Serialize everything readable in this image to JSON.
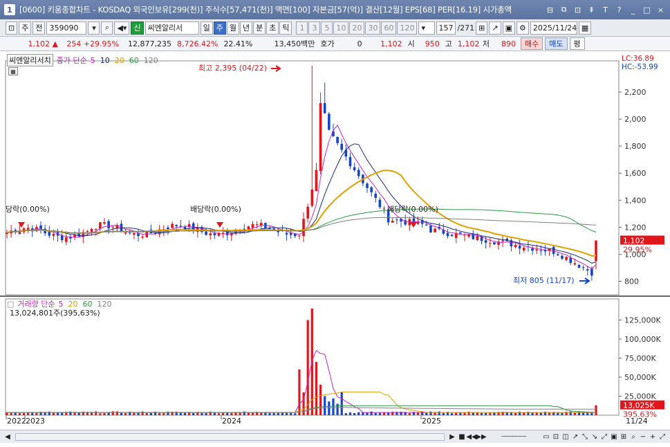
{
  "window": {
    "icon": "1",
    "title": "[0600] 키움종합차트 - KOSDAQ 외국인보유[299(천)] 주식수[57,471(천)] 액면[100] 자본금[57(억)] 결산[12월] EPS[68] PER[16.19] 시가총액",
    "buttons": [
      "⊟",
      "⧉",
      "⊡",
      "⇞",
      "T",
      "?",
      "_",
      "□",
      "×"
    ]
  },
  "toolbar": {
    "period": "주",
    "market": "전",
    "code": "359090",
    "badge": "신",
    "stock_name": "씨엔알리서",
    "periods": [
      {
        "label": "일",
        "active": false
      },
      {
        "label": "주",
        "active": true
      },
      {
        "label": "월",
        "active": false
      },
      {
        "label": "년",
        "active": false
      },
      {
        "label": "분",
        "active": false
      },
      {
        "label": "초",
        "active": false
      },
      {
        "label": "틱",
        "active": false
      }
    ],
    "intervals": [
      "1",
      "3",
      "5",
      "10",
      "20",
      "30",
      "60",
      "120"
    ],
    "count": "157",
    "total": "/271",
    "date": "2025/11/24"
  },
  "quote": {
    "price": "1,102",
    "change": "254",
    "change_pct": "+29.95%",
    "volume": "12,877,235",
    "volume_pct": "8,726.42%",
    "turnover": "22.41%",
    "amount": "13,450백만",
    "hoga_label": "호가",
    "hoga_value": "0",
    "last": "1,102",
    "open_label": "시",
    "open": "950",
    "high_label": "고",
    "high": "1,102",
    "low_label": "저",
    "low": "890",
    "buy": "매수",
    "sell": "매도",
    "eval": "평"
  },
  "price_panel": {
    "name": "씨엔알리서치",
    "legend_title": "종가 단순",
    "ma": [
      {
        "label": "5",
        "color": "#cc22cc"
      },
      {
        "label": "10",
        "color": "#1a2a80"
      },
      {
        "label": "20",
        "color": "#e0a000"
      },
      {
        "label": "60",
        "color": "#2a9a44"
      },
      {
        "label": "120",
        "color": "#808080"
      }
    ],
    "lc": "LC:36.89",
    "hc": "HC:-53.99",
    "high_note": "최고 2,395 (04/22)",
    "low_note": "최저 805 (11/17)",
    "dividends": [
      "당락(0.00%)",
      "배당락(0.00%)",
      "배당락(0.00%)"
    ],
    "yticks": [
      "2,200",
      "2,000",
      "1,800",
      "1,600",
      "1,400",
      "1,200",
      "1,000",
      "800"
    ],
    "current_price": "1,102",
    "current_pct": "29.95%"
  },
  "volume_panel": {
    "legend_title": "거래량 단순",
    "ma": [
      {
        "label": "5",
        "color": "#cc22cc"
      },
      {
        "label": "20",
        "color": "#e0a000"
      },
      {
        "label": "60",
        "color": "#2a9a44"
      },
      {
        "label": "120",
        "color": "#808080"
      }
    ],
    "current_text": "13,024,801주(395,63%)",
    "yticks": [
      "125,000K",
      "100,000K",
      "75,000K",
      "50,000K",
      "25,000K"
    ],
    "current_vol": "13,025K",
    "current_pct": "395.63%"
  },
  "xaxis": {
    "labels": [
      "2022",
      "2023",
      "2024",
      "2025"
    ],
    "right_label": "11/24"
  },
  "chart_data": {
    "type": "candlestick",
    "price_range": [
      800,
      2395
    ],
    "price_high": {
      "value": 2395,
      "date": "04/22"
    },
    "price_low": {
      "value": 805,
      "date": "11/17"
    },
    "last": {
      "open": 950,
      "high": 1102,
      "low": 890,
      "close": 1102,
      "change_pct": 29.95
    },
    "volume_last": 13025
  },
  "colors": {
    "up": "#e0161b",
    "down": "#1445c8",
    "ma5": "#cc22cc",
    "ma10": "#1a2a80",
    "ma20": "#e0a000",
    "ma60": "#2a9a44",
    "ma120": "#808080"
  }
}
